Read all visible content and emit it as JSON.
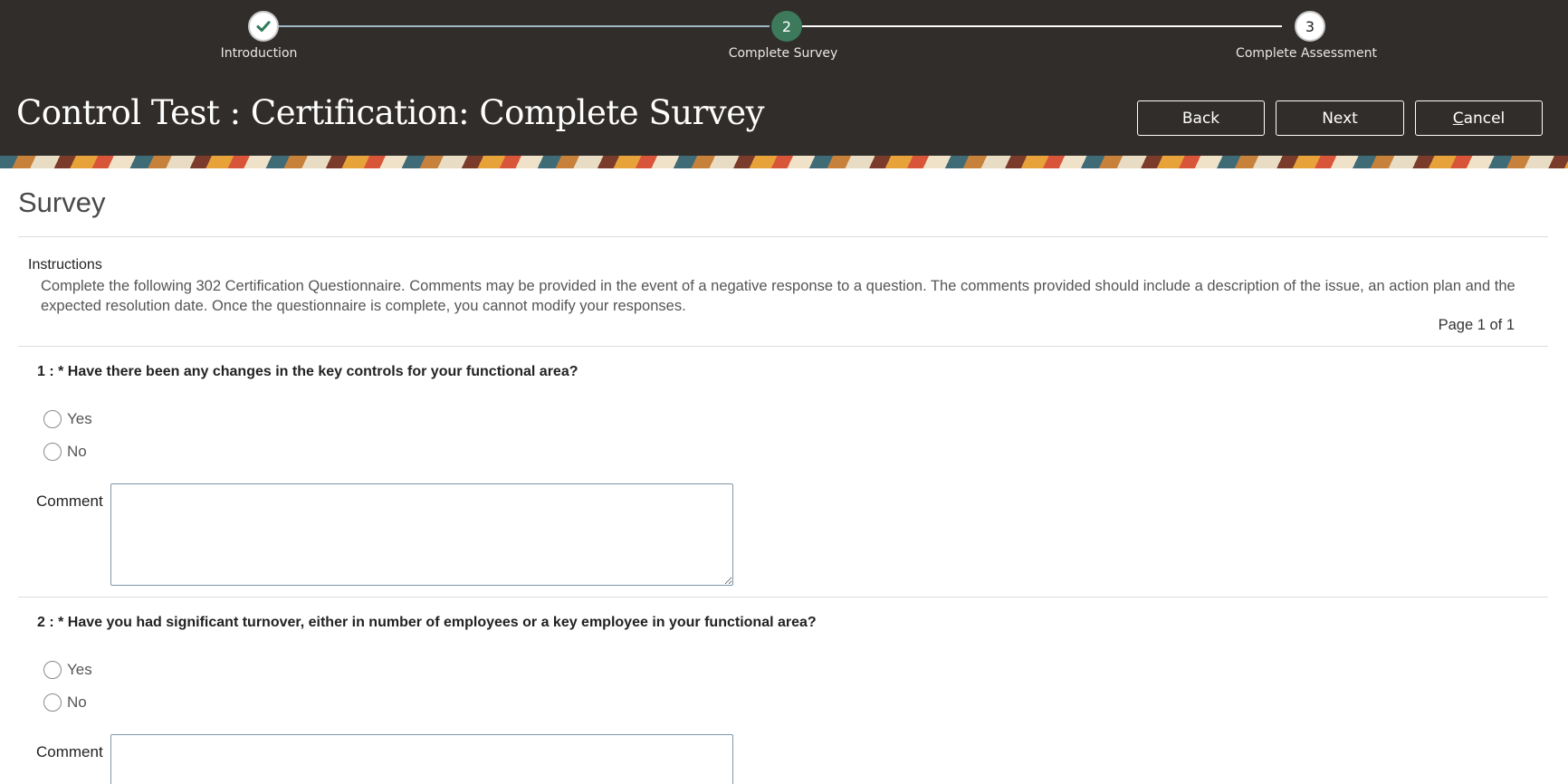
{
  "train": {
    "steps": [
      {
        "label": "Introduction",
        "number": "",
        "state": "complete"
      },
      {
        "label": "Complete Survey",
        "number": "2",
        "state": "current"
      },
      {
        "label": "Complete Assessment",
        "number": "3",
        "state": "pending"
      }
    ]
  },
  "header": {
    "title": "Control Test : Certification: Complete Survey",
    "back_label": "Back",
    "next_label": "Next",
    "cancel_label_underlined": "C",
    "cancel_label_rest": "ancel"
  },
  "survey": {
    "title": "Survey",
    "instructions_label": "Instructions",
    "instructions_text": "Complete the following 302 Certification Questionnaire. Comments may be provided in the event of a negative response to a question. The comments provided should include a description of the issue, an action plan and the expected resolution date. Once the questionnaire is complete, you cannot modify your responses.",
    "pager": "Page 1 of 1",
    "questions": [
      {
        "text": "1 : * Have there been any changes in the key controls for your functional area?",
        "options": [
          "Yes",
          "No"
        ],
        "comment_label": "Comment",
        "comment_value": ""
      },
      {
        "text": "2 : * Have you had significant turnover, either in number of employees or a key employee in your functional area?",
        "options": [
          "Yes",
          "No"
        ],
        "comment_label": "Comment",
        "comment_value": ""
      }
    ]
  },
  "colors": {
    "header_bg": "#312d2a",
    "current_step": "#3c7a5b"
  },
  "icons": {
    "complete_step": "checkmark-icon"
  }
}
